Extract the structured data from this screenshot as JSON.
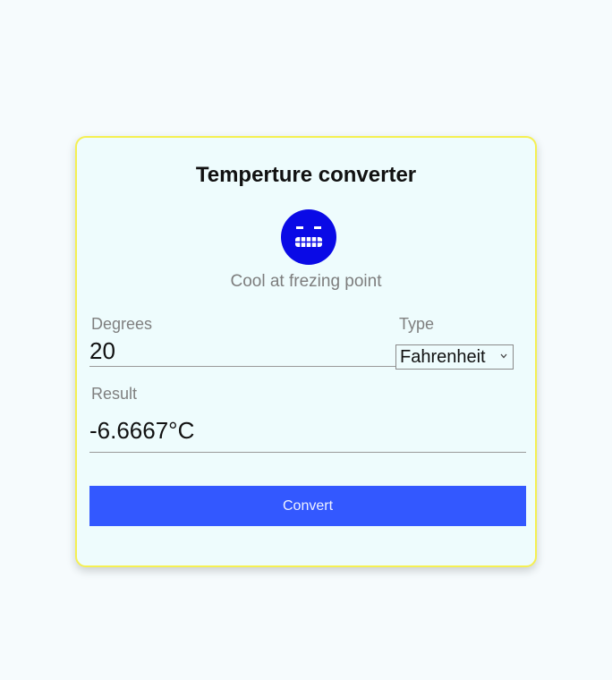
{
  "app": {
    "title": "Temperture converter",
    "status_text": "Cool at frezing point",
    "status_icon": "grimacing-face-icon",
    "status_icon_color": "#0a0ae6"
  },
  "form": {
    "degrees_label": "Degrees",
    "degrees_value": "20",
    "type_label": "Type",
    "type_selected": "Fahrenheit",
    "result_label": "Result",
    "result_value": "-6.6667°C",
    "convert_label": "Convert"
  },
  "colors": {
    "card_border": "#f5f052",
    "card_background": "#eefcfd",
    "button": "#3358ff"
  }
}
